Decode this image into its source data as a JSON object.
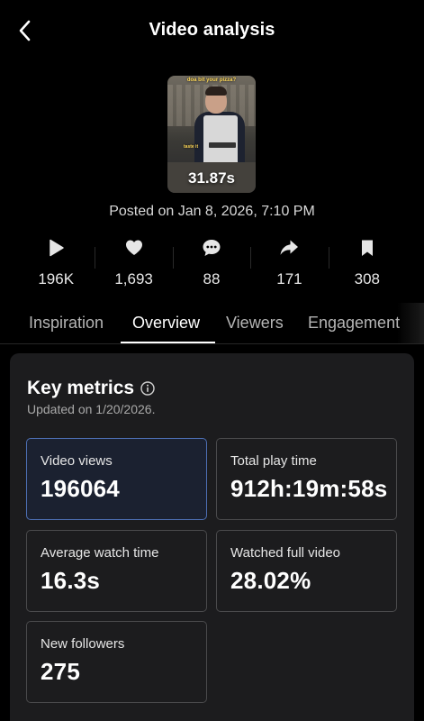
{
  "header": {
    "title": "Video analysis"
  },
  "video": {
    "duration": "31.87s",
    "posted": "Posted on Jan 8, 2026, 7:10 PM",
    "caption_top": "doa bit your pizza?",
    "caption_mid": "taste it"
  },
  "stats": [
    {
      "icon": "play-icon",
      "value": "196K"
    },
    {
      "icon": "heart-icon",
      "value": "1,693"
    },
    {
      "icon": "comment-icon",
      "value": "88"
    },
    {
      "icon": "share-icon",
      "value": "171"
    },
    {
      "icon": "bookmark-icon",
      "value": "308"
    }
  ],
  "tabs": [
    {
      "label": "Inspiration",
      "active": false
    },
    {
      "label": "Overview",
      "active": true
    },
    {
      "label": "Viewers",
      "active": false
    },
    {
      "label": "Engagement",
      "active": false
    }
  ],
  "key_metrics": {
    "title": "Key metrics",
    "updated": "Updated on 1/20/2026.",
    "metrics": [
      {
        "label": "Video views",
        "value": "196064",
        "selected": true
      },
      {
        "label": "Total play time",
        "value": "912h:19m:58s",
        "selected": false
      },
      {
        "label": "Average watch time",
        "value": "16.3s",
        "selected": false
      },
      {
        "label": "Watched full video",
        "value": "28.02%",
        "selected": false
      },
      {
        "label": "New followers",
        "value": "275",
        "selected": false
      }
    ]
  },
  "colors": {
    "background": "#000000",
    "card": "#1c1c1e",
    "selected_border": "#4d6fb3"
  }
}
